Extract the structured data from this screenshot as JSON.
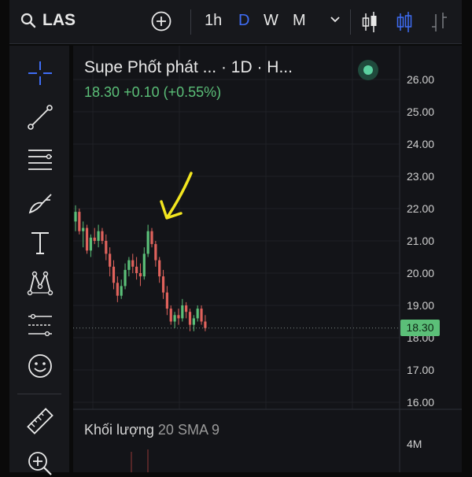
{
  "header": {
    "symbol": "LAS",
    "timeframes": [
      "1h",
      "D",
      "W",
      "M"
    ],
    "active_timeframe": "D"
  },
  "chart": {
    "title": "Supe Phốt phát ...  · 1D · H...",
    "last_price": "18.30",
    "change": "+0.10",
    "change_pct": "(+0.55%)",
    "price_tag": "18.30",
    "volume_label": "Khối lượng",
    "volume_params": "20 SMA 9",
    "volume_axis_label": "4M"
  },
  "colors": {
    "up": "#5bbf78",
    "down": "#e0625c",
    "accent": "#3f6df5",
    "annotation": "#f2e51f"
  },
  "chart_data": {
    "type": "candlestick",
    "y_ticks": [
      "26.00",
      "25.00",
      "24.00",
      "23.00",
      "22.00",
      "21.00",
      "20.00",
      "19.00",
      "18.00",
      "17.00",
      "16.00"
    ],
    "ylim": [
      16,
      26
    ],
    "last_price": 18.3,
    "series": [
      {
        "ohlc": [
          [
            21.6,
            22.1,
            21.3,
            21.9
          ],
          [
            21.9,
            22.0,
            21.2,
            21.3
          ],
          [
            21.3,
            21.6,
            20.8,
            21.4
          ],
          [
            21.4,
            21.5,
            20.6,
            20.7
          ],
          [
            20.7,
            21.2,
            20.5,
            21.1
          ],
          [
            21.1,
            21.4,
            20.9,
            21.0
          ],
          [
            21.0,
            21.5,
            20.8,
            21.3
          ],
          [
            21.3,
            21.4,
            20.9,
            21.0
          ],
          [
            21.0,
            21.2,
            20.4,
            20.6
          ],
          [
            20.6,
            20.8,
            19.9,
            20.2
          ],
          [
            20.2,
            20.4,
            19.5,
            19.7
          ],
          [
            19.7,
            19.9,
            19.1,
            19.3
          ],
          [
            19.3,
            19.8,
            19.2,
            19.6
          ],
          [
            19.6,
            20.3,
            19.5,
            20.1
          ],
          [
            20.1,
            20.5,
            19.9,
            20.4
          ],
          [
            20.4,
            20.6,
            20.0,
            20.2
          ],
          [
            20.2,
            20.5,
            19.8,
            20.0
          ],
          [
            20.0,
            20.3,
            19.6,
            19.9
          ],
          [
            19.9,
            20.8,
            19.8,
            20.6
          ],
          [
            20.6,
            21.5,
            20.5,
            21.3
          ],
          [
            21.3,
            21.4,
            20.8,
            20.9
          ],
          [
            20.9,
            21.0,
            20.2,
            20.4
          ],
          [
            20.4,
            20.5,
            19.7,
            19.9
          ],
          [
            19.9,
            20.1,
            19.2,
            19.4
          ],
          [
            19.4,
            19.6,
            18.7,
            18.9
          ],
          [
            18.9,
            19.0,
            18.4,
            18.5
          ],
          [
            18.5,
            18.8,
            18.3,
            18.7
          ],
          [
            18.7,
            18.9,
            18.4,
            18.6
          ],
          [
            18.6,
            19.2,
            18.5,
            19.0
          ],
          [
            19.0,
            19.1,
            18.6,
            18.8
          ],
          [
            18.8,
            18.9,
            18.2,
            18.4
          ],
          [
            18.4,
            18.7,
            18.2,
            18.6
          ],
          [
            18.6,
            19.0,
            18.5,
            18.9
          ],
          [
            18.9,
            19.0,
            18.4,
            18.5
          ],
          [
            18.5,
            18.7,
            18.2,
            18.3
          ]
        ]
      }
    ]
  }
}
